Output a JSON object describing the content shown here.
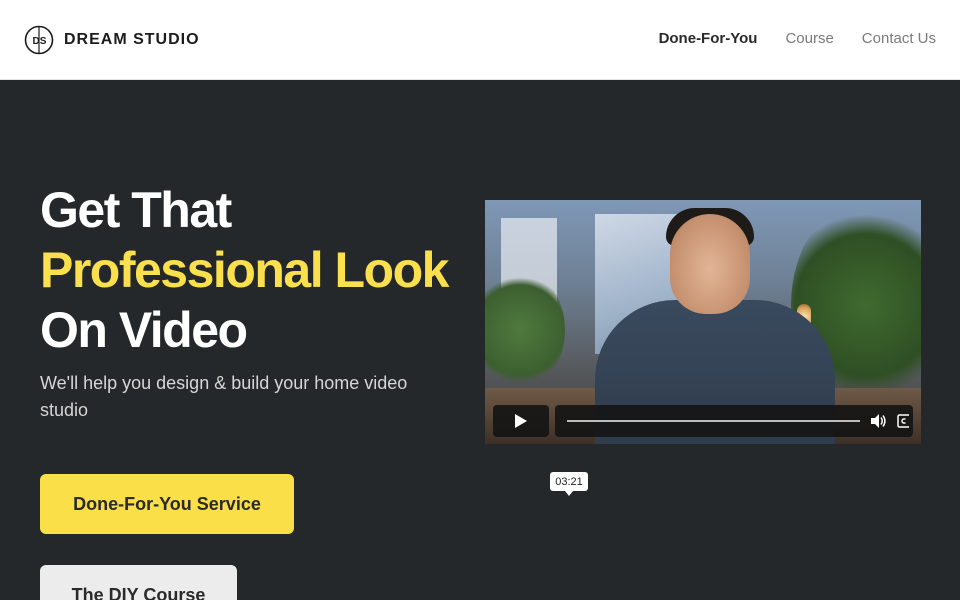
{
  "brand": {
    "name": "DREAM STUDIO",
    "logo_letters": "DS"
  },
  "nav": {
    "items": [
      {
        "label": "Done-For-You",
        "active": true
      },
      {
        "label": "Course",
        "active": false
      },
      {
        "label": "Contact Us",
        "active": false
      }
    ]
  },
  "hero": {
    "headline_line1": "Get That",
    "headline_line2": "Professional Look",
    "headline_line3": "On Video",
    "subtitle": "We'll help you design & build your home video studio",
    "primary_button": "Done-For-You Service",
    "secondary_button": "The DIY Course"
  },
  "video": {
    "time_tooltip": "03:21",
    "icons": {
      "play": "play-icon",
      "volume": "volume-icon",
      "captions": "captions-icon"
    }
  },
  "colors": {
    "accent": "#fbdf49",
    "hero_bg": "#25282a",
    "nav_bg": "#ffffff"
  }
}
